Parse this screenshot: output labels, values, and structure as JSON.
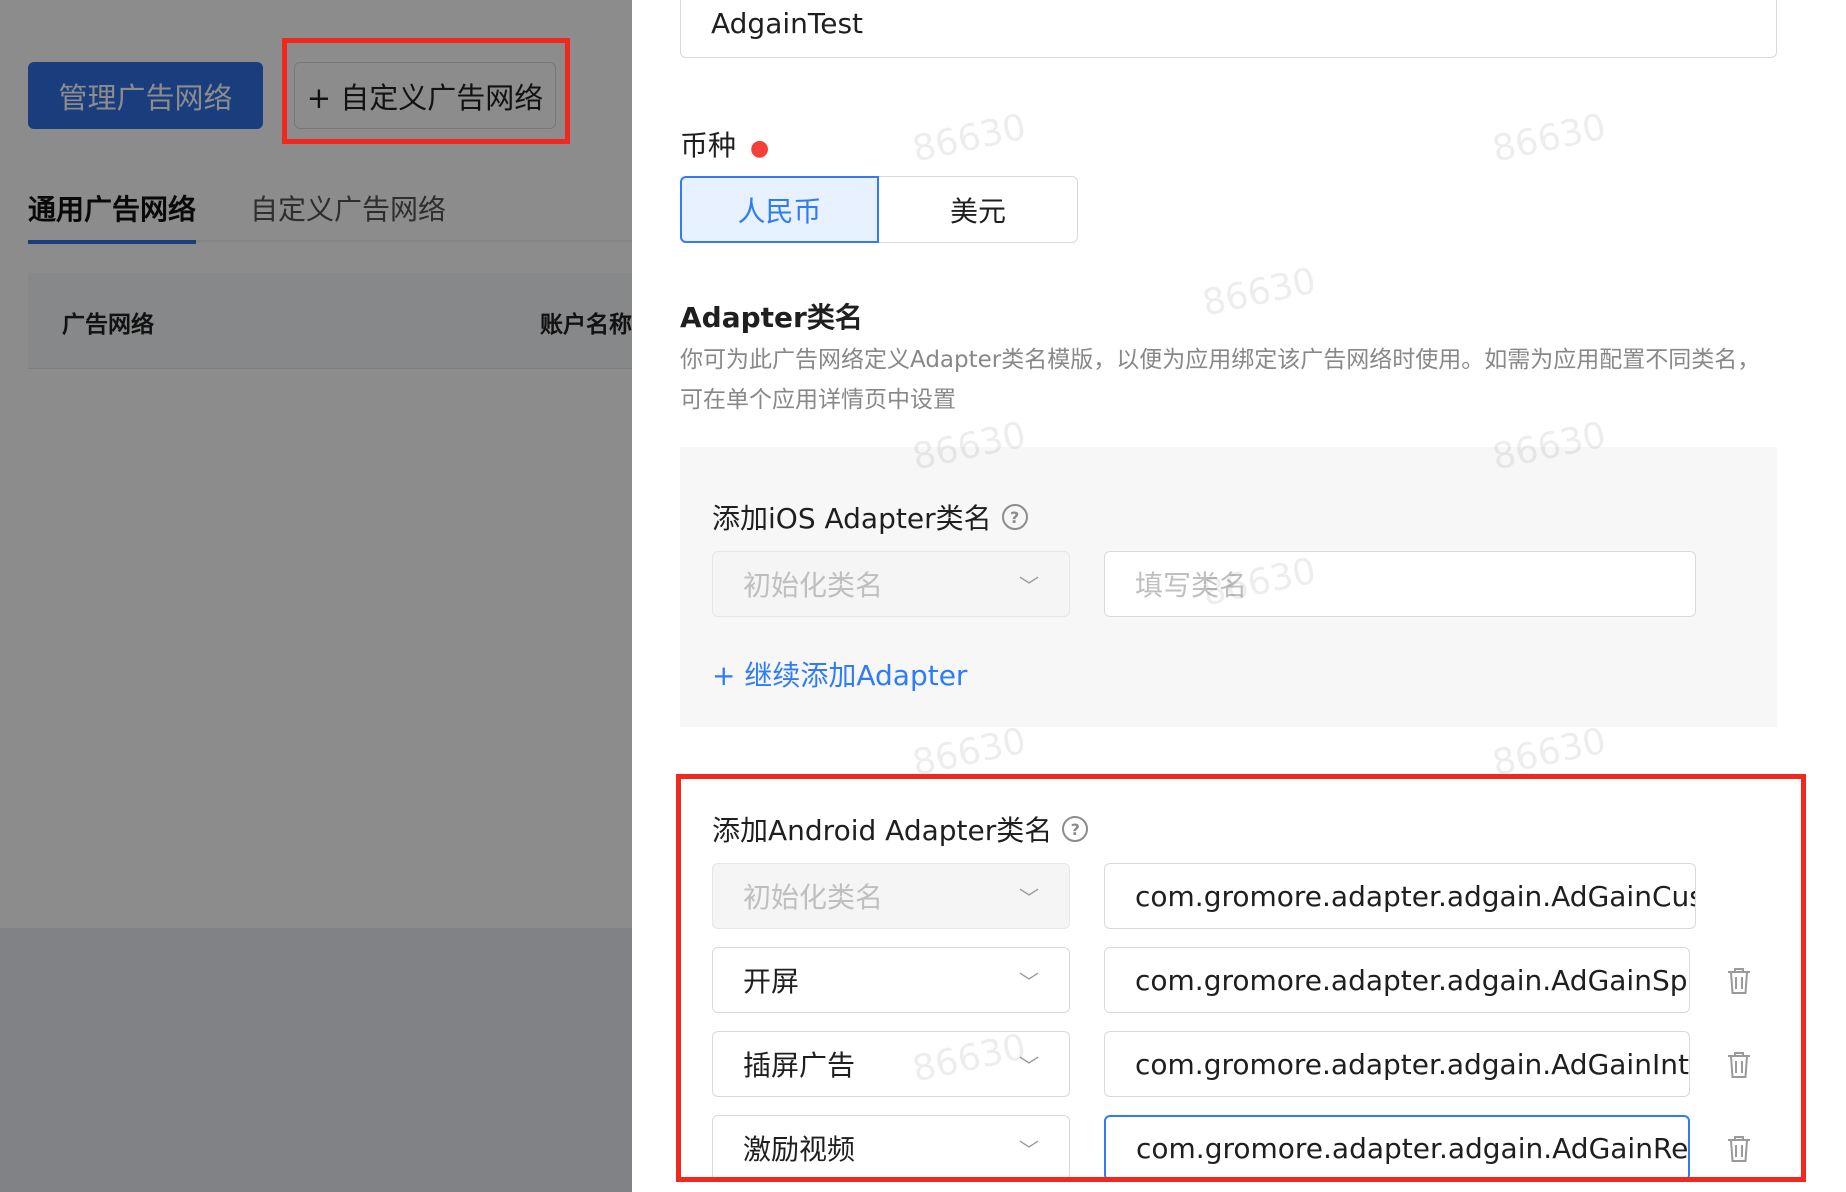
{
  "background": {
    "manage_button": "管理广告网络",
    "custom_button": "+ 自定义广告网络",
    "tabs": [
      "通用广告网络",
      "自定义广告网络"
    ],
    "table_headers": [
      "广告网络",
      "账户名称"
    ]
  },
  "drawer": {
    "name_value": "AdgainTest",
    "currency": {
      "label": "币种",
      "options": [
        "人民币",
        "美元"
      ],
      "selected": "人民币"
    },
    "adapter": {
      "title": "Adapter类名",
      "description": "你可为此广告网络定义Adapter类名模版，以便为应用绑定该广告网络时使用。如需为应用配置不同类名，可在单个应用详情页中设置",
      "ios": {
        "label": "添加iOS Adapter类名",
        "row": {
          "select": "初始化类名",
          "input_placeholder": "填写类名"
        },
        "add_more": "+ 继续添加Adapter"
      },
      "android": {
        "label": "添加Android Adapter类名",
        "rows": [
          {
            "select": "初始化类名",
            "value": "com.gromore.adapter.adgain.AdGainCust"
          },
          {
            "select": "开屏",
            "value": "com.gromore.adapter.adgain.AdGainSpla"
          },
          {
            "select": "插屏广告",
            "value": "com.gromore.adapter.adgain.AdGainInter"
          },
          {
            "select": "激励视频",
            "value": "com.gromore.adapter.adgain.AdGainRew"
          }
        ]
      }
    }
  },
  "watermark": "86630",
  "colors": {
    "primary": "#2f6fe4",
    "link": "#2f7cf6",
    "highlight": "#f0281e"
  }
}
